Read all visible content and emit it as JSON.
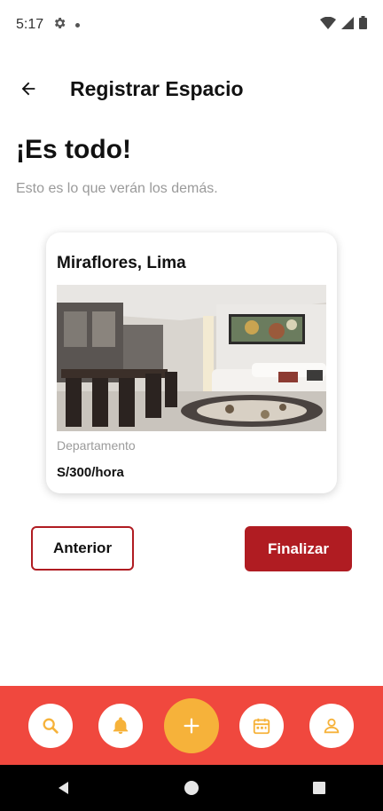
{
  "status": {
    "time": "5:17",
    "settings_icon": "gear-icon",
    "wifi_icon": "wifi-icon",
    "signal_icon": "signal-icon",
    "battery_icon": "battery-icon"
  },
  "topbar": {
    "title": "Registrar Espacio",
    "back_icon": "arrow-left-icon"
  },
  "content": {
    "heading": "¡Es todo!",
    "subtitle": "Esto es lo que verán los demás."
  },
  "listing": {
    "location": "Miraflores, Lima",
    "type": "Departamento",
    "price": "S/300/hora",
    "image": "living-room-photo"
  },
  "actions": {
    "previous": "Anterior",
    "finish": "Finalizar"
  },
  "bottom_nav": {
    "items": [
      "search-icon",
      "bell-icon",
      "plus-icon",
      "calendar-icon",
      "user-icon"
    ],
    "background": "#f0483e",
    "accent": "#f6b23a"
  },
  "colors": {
    "primary": "#b01c22",
    "muted": "#9a9a9a"
  }
}
